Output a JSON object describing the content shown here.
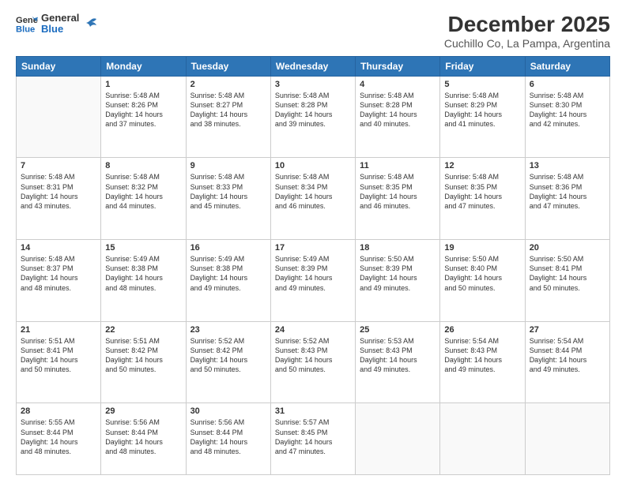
{
  "logo": {
    "line1": "General",
    "line2": "Blue"
  },
  "title": "December 2025",
  "subtitle": "Cuchillo Co, La Pampa, Argentina",
  "weekdays": [
    "Sunday",
    "Monday",
    "Tuesday",
    "Wednesday",
    "Thursday",
    "Friday",
    "Saturday"
  ],
  "weeks": [
    [
      {
        "day": "",
        "info": ""
      },
      {
        "day": "1",
        "info": "Sunrise: 5:48 AM\nSunset: 8:26 PM\nDaylight: 14 hours\nand 37 minutes."
      },
      {
        "day": "2",
        "info": "Sunrise: 5:48 AM\nSunset: 8:27 PM\nDaylight: 14 hours\nand 38 minutes."
      },
      {
        "day": "3",
        "info": "Sunrise: 5:48 AM\nSunset: 8:28 PM\nDaylight: 14 hours\nand 39 minutes."
      },
      {
        "day": "4",
        "info": "Sunrise: 5:48 AM\nSunset: 8:28 PM\nDaylight: 14 hours\nand 40 minutes."
      },
      {
        "day": "5",
        "info": "Sunrise: 5:48 AM\nSunset: 8:29 PM\nDaylight: 14 hours\nand 41 minutes."
      },
      {
        "day": "6",
        "info": "Sunrise: 5:48 AM\nSunset: 8:30 PM\nDaylight: 14 hours\nand 42 minutes."
      }
    ],
    [
      {
        "day": "7",
        "info": "Sunrise: 5:48 AM\nSunset: 8:31 PM\nDaylight: 14 hours\nand 43 minutes."
      },
      {
        "day": "8",
        "info": "Sunrise: 5:48 AM\nSunset: 8:32 PM\nDaylight: 14 hours\nand 44 minutes."
      },
      {
        "day": "9",
        "info": "Sunrise: 5:48 AM\nSunset: 8:33 PM\nDaylight: 14 hours\nand 45 minutes."
      },
      {
        "day": "10",
        "info": "Sunrise: 5:48 AM\nSunset: 8:34 PM\nDaylight: 14 hours\nand 46 minutes."
      },
      {
        "day": "11",
        "info": "Sunrise: 5:48 AM\nSunset: 8:35 PM\nDaylight: 14 hours\nand 46 minutes."
      },
      {
        "day": "12",
        "info": "Sunrise: 5:48 AM\nSunset: 8:35 PM\nDaylight: 14 hours\nand 47 minutes."
      },
      {
        "day": "13",
        "info": "Sunrise: 5:48 AM\nSunset: 8:36 PM\nDaylight: 14 hours\nand 47 minutes."
      }
    ],
    [
      {
        "day": "14",
        "info": "Sunrise: 5:48 AM\nSunset: 8:37 PM\nDaylight: 14 hours\nand 48 minutes."
      },
      {
        "day": "15",
        "info": "Sunrise: 5:49 AM\nSunset: 8:38 PM\nDaylight: 14 hours\nand 48 minutes."
      },
      {
        "day": "16",
        "info": "Sunrise: 5:49 AM\nSunset: 8:38 PM\nDaylight: 14 hours\nand 49 minutes."
      },
      {
        "day": "17",
        "info": "Sunrise: 5:49 AM\nSunset: 8:39 PM\nDaylight: 14 hours\nand 49 minutes."
      },
      {
        "day": "18",
        "info": "Sunrise: 5:50 AM\nSunset: 8:39 PM\nDaylight: 14 hours\nand 49 minutes."
      },
      {
        "day": "19",
        "info": "Sunrise: 5:50 AM\nSunset: 8:40 PM\nDaylight: 14 hours\nand 50 minutes."
      },
      {
        "day": "20",
        "info": "Sunrise: 5:50 AM\nSunset: 8:41 PM\nDaylight: 14 hours\nand 50 minutes."
      }
    ],
    [
      {
        "day": "21",
        "info": "Sunrise: 5:51 AM\nSunset: 8:41 PM\nDaylight: 14 hours\nand 50 minutes."
      },
      {
        "day": "22",
        "info": "Sunrise: 5:51 AM\nSunset: 8:42 PM\nDaylight: 14 hours\nand 50 minutes."
      },
      {
        "day": "23",
        "info": "Sunrise: 5:52 AM\nSunset: 8:42 PM\nDaylight: 14 hours\nand 50 minutes."
      },
      {
        "day": "24",
        "info": "Sunrise: 5:52 AM\nSunset: 8:43 PM\nDaylight: 14 hours\nand 50 minutes."
      },
      {
        "day": "25",
        "info": "Sunrise: 5:53 AM\nSunset: 8:43 PM\nDaylight: 14 hours\nand 49 minutes."
      },
      {
        "day": "26",
        "info": "Sunrise: 5:54 AM\nSunset: 8:43 PM\nDaylight: 14 hours\nand 49 minutes."
      },
      {
        "day": "27",
        "info": "Sunrise: 5:54 AM\nSunset: 8:44 PM\nDaylight: 14 hours\nand 49 minutes."
      }
    ],
    [
      {
        "day": "28",
        "info": "Sunrise: 5:55 AM\nSunset: 8:44 PM\nDaylight: 14 hours\nand 48 minutes."
      },
      {
        "day": "29",
        "info": "Sunrise: 5:56 AM\nSunset: 8:44 PM\nDaylight: 14 hours\nand 48 minutes."
      },
      {
        "day": "30",
        "info": "Sunrise: 5:56 AM\nSunset: 8:44 PM\nDaylight: 14 hours\nand 48 minutes."
      },
      {
        "day": "31",
        "info": "Sunrise: 5:57 AM\nSunset: 8:45 PM\nDaylight: 14 hours\nand 47 minutes."
      },
      {
        "day": "",
        "info": ""
      },
      {
        "day": "",
        "info": ""
      },
      {
        "day": "",
        "info": ""
      }
    ]
  ]
}
